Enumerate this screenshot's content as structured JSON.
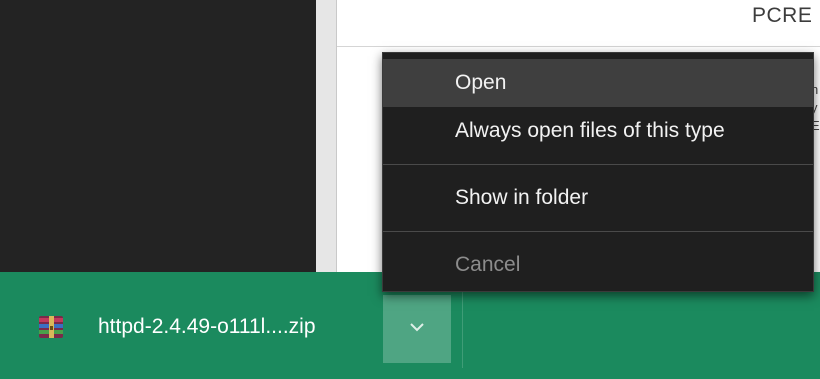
{
  "background_page": {
    "heading_fragment": "PCRE",
    "peek_chars": [
      "h",
      "y",
      "E"
    ]
  },
  "context_menu": {
    "items": [
      {
        "label": "Open",
        "state": "hovered"
      },
      {
        "label": "Always open files of this type",
        "state": "normal"
      },
      {
        "label": "Show in folder",
        "state": "normal"
      },
      {
        "label": "Cancel",
        "state": "disabled"
      }
    ]
  },
  "download_bar": {
    "file_name": "httpd-2.4.49-o111l....zip",
    "file_icon": "archive-icon",
    "dropdown_icon": "chevron-down-icon",
    "bar_color": "#1b8a5e"
  }
}
